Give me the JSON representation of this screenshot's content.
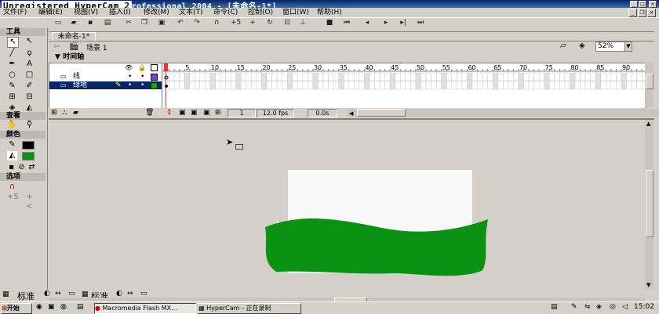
{
  "window": {
    "title": "Unregistered HyperCam 2",
    "title_rest": "rofessional 2004 - [未命名-1*]"
  },
  "menu": [
    "文件(F)",
    "编辑(E)",
    "视图(V)",
    "插入(I)",
    "修改(M)",
    "文本(T)",
    "命令(C)",
    "控制(O)",
    "窗口(W)",
    "帮助(H)"
  ],
  "tools_panel": {
    "header": "工具",
    "view_header": "查看",
    "color_header": "颜色",
    "options_header": "选项"
  },
  "document": {
    "tab": "未命名-1*",
    "scene": "场景 1",
    "zoom": "52%"
  },
  "timeline": {
    "header": "时间轴",
    "layers": [
      {
        "name": "线"
      },
      {
        "name": "绿地"
      }
    ],
    "frame_labels": [
      "1",
      "5",
      "10",
      "15",
      "20",
      "25",
      "30",
      "35",
      "40",
      "45",
      "50",
      "55",
      "60",
      "65",
      "70",
      "75",
      "80",
      "85",
      "90"
    ],
    "current_frame": "1",
    "fps": "12.0 fps",
    "time": "0.0s"
  },
  "bottom_dock": [
    "标准",
    "标准"
  ],
  "taskbar": {
    "start": "开始",
    "tasks": [
      {
        "label": "Macromedia Flash MX..."
      },
      {
        "label": "HyperCam - 正在录制"
      }
    ],
    "clock": "15:02"
  },
  "colors": {
    "stage": "#f8f8f8",
    "grass": "#0b9212",
    "workspace": "#d4d0c8"
  }
}
